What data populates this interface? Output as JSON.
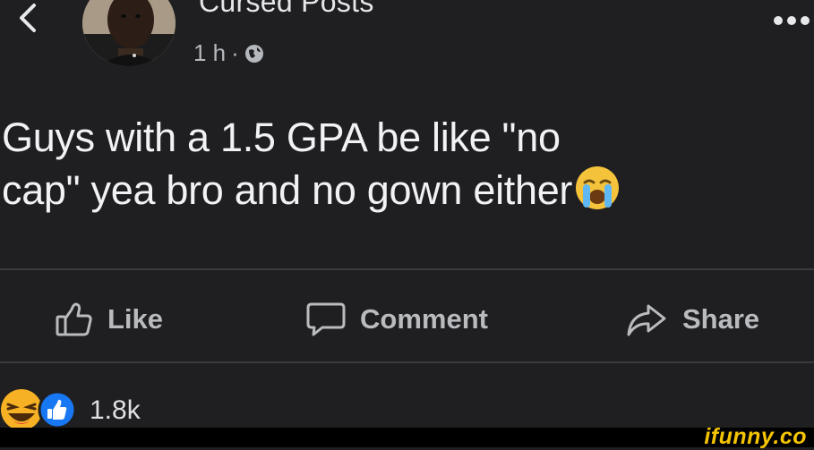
{
  "header": {
    "back_icon": "chevron-left-icon",
    "page_name": "Cursed Posts",
    "timestamp": "1 h",
    "separator": "·",
    "audience_icon": "globe-icon",
    "more_icon": "ellipsis-icon"
  },
  "post": {
    "text_line_1": "Guys with a 1.5 GPA be like \"no",
    "text_line_2": "cap\" yea bro and no gown either",
    "emoji": "crying-face-emoji"
  },
  "actions": {
    "like_label": "Like",
    "comment_label": "Comment",
    "share_label": "Share"
  },
  "reactions": {
    "icons": [
      "laughing-reaction-icon",
      "like-reaction-icon"
    ],
    "count": "1.8k"
  },
  "watermark": {
    "text": "ifunny.co",
    "color": "#f5c400"
  },
  "colors": {
    "background": "#1f1f21",
    "text_primary": "#f1f2f4",
    "text_secondary": "#b4b7bc",
    "like_blue": "#1877f2",
    "haha_yellow": "#f7b125"
  }
}
